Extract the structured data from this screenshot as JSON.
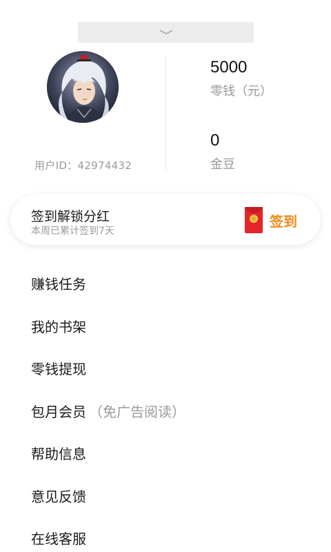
{
  "profile": {
    "user_id_label": "用户ID：",
    "user_id": "42974432"
  },
  "stats": {
    "balance_value": "5000",
    "balance_label": "零钱（元）",
    "beans_value": "0",
    "beans_label": "金豆"
  },
  "signin": {
    "title": "签到解锁分红",
    "subtitle": "本周已累计签到7天",
    "button_label": "签到",
    "accent_color": "#f08a1a"
  },
  "menu": [
    {
      "label": "赚钱任务",
      "note": ""
    },
    {
      "label": "我的书架",
      "note": ""
    },
    {
      "label": "零钱提现",
      "note": ""
    },
    {
      "label": "包月会员",
      "note": "（免广告阅读）"
    },
    {
      "label": "帮助信息",
      "note": ""
    },
    {
      "label": "意见反馈",
      "note": ""
    },
    {
      "label": "在线客服",
      "note": ""
    }
  ],
  "icons": {
    "collapse": "chevron-down-icon",
    "signin": "red-envelope-icon"
  }
}
